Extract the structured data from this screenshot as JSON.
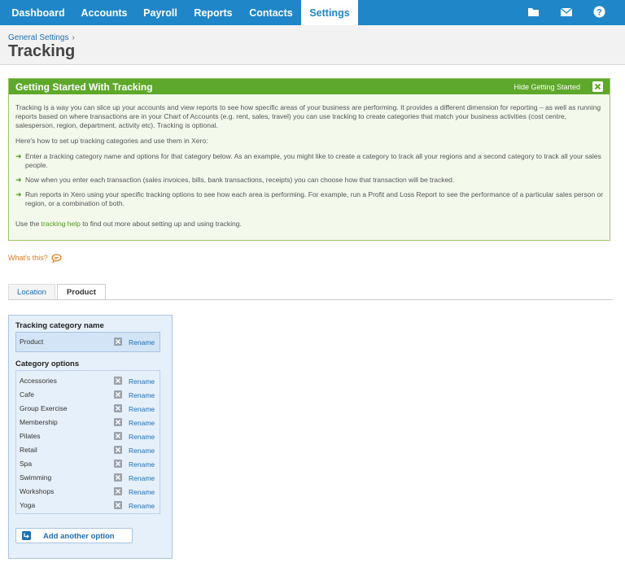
{
  "nav": {
    "items": [
      "Dashboard",
      "Accounts",
      "Payroll",
      "Reports",
      "Contacts",
      "Settings"
    ],
    "active": "Settings",
    "icons": [
      "folder-icon",
      "mail-icon",
      "help-icon"
    ],
    "color": "#1f87c8"
  },
  "header": {
    "breadcrumb": "General Settings",
    "breadcrumb_sep": "›",
    "title": "Tracking"
  },
  "getting_started": {
    "title": "Getting Started With Tracking",
    "hide_label": "Hide Getting Started",
    "intro": "Tracking is a way you can slice up your accounts and view reports to see how specific areas of your business are performing. It provides a different dimension for reporting – as well as running reports based on where transactions are in your Chart of Accounts (e.g. rent, sales, travel) you can use tracking to create categories that match your business activities (cost centre, salesperson, region, department, activity etc). Tracking is optional.",
    "how_to": "Here's how to set up tracking categories and use them in Xero:",
    "steps": [
      "Enter a tracking category name and options for that category below. As an example, you might like to create a category to track all your regions and a second category to track all your sales people.",
      "Now when you enter each transaction (sales invoices, bills, bank transactions, receipts) you can choose how that transaction will be tracked.",
      "Run reports in Xero using your specific tracking options to see how each area is performing. For example, run a Profit and Loss Report to see the performance of a particular sales person or region, or a combination of both."
    ],
    "footer_pre": "Use the",
    "footer_link": "tracking help",
    "footer_post": "to find out more about setting up and using tracking.",
    "accent": "#5ea82c"
  },
  "whats_this": "What's this?",
  "tabs": [
    "Location",
    "Product"
  ],
  "active_tab": "Product",
  "tracking": {
    "category_label": "Tracking category name",
    "category_name": "Product",
    "options_label": "Category options",
    "rename_label": "Rename",
    "options": [
      "Accessories",
      "Cafe",
      "Group Exercise",
      "Membership",
      "Pilates",
      "Retail",
      "Spa",
      "Swimming",
      "Workshops",
      "Yoga"
    ],
    "add_label": "Add another option"
  }
}
